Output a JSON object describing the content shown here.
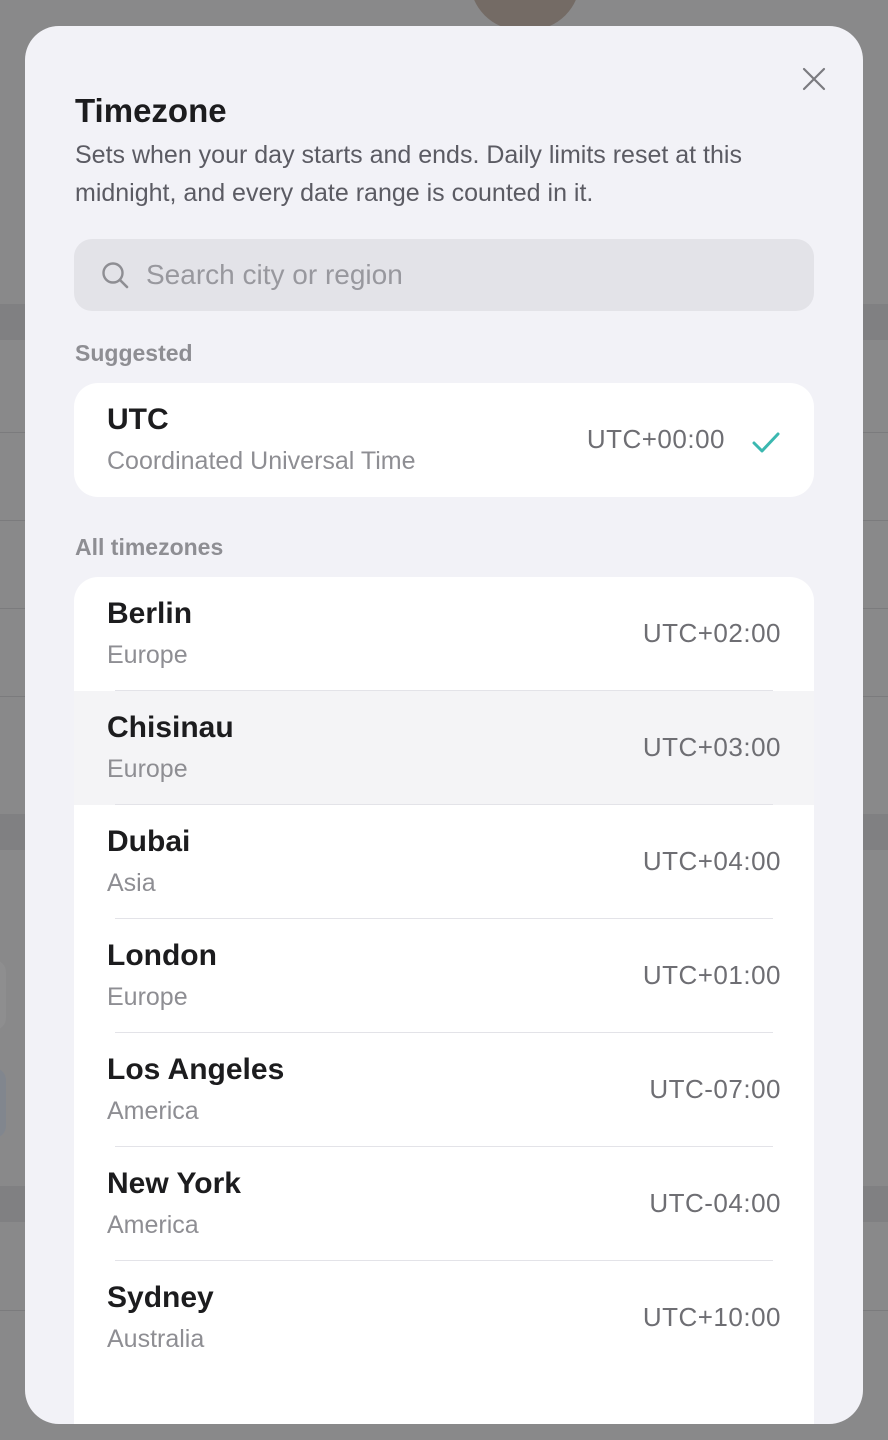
{
  "modal": {
    "title": "Timezone",
    "description": "Sets when your day starts and ends. Daily limits reset at this midnight, and every date range is counted in it.",
    "close_icon": "close-icon"
  },
  "search": {
    "placeholder": "Search city or region",
    "value": "",
    "icon": "search-icon"
  },
  "suggested": {
    "label": "Suggested",
    "item": {
      "name": "UTC",
      "region": "Coordinated Universal Time",
      "offset": "UTC+00:00",
      "selected": true,
      "check_icon": "checkmark-icon"
    }
  },
  "all": {
    "label": "All timezones",
    "items": [
      {
        "name": "Berlin",
        "region": "Europe",
        "offset": "UTC+02:00"
      },
      {
        "name": "Chisinau",
        "region": "Europe",
        "offset": "UTC+03:00"
      },
      {
        "name": "Dubai",
        "region": "Asia",
        "offset": "UTC+04:00"
      },
      {
        "name": "London",
        "region": "Europe",
        "offset": "UTC+01:00"
      },
      {
        "name": "Los Angeles",
        "region": "America",
        "offset": "UTC-07:00"
      },
      {
        "name": "New York",
        "region": "America",
        "offset": "UTC-04:00"
      },
      {
        "name": "Sydney",
        "region": "Australia",
        "offset": "UTC+10:00"
      }
    ]
  },
  "colors": {
    "accent_check": "#3bb8b0",
    "modal_bg": "#f2f2f7",
    "card_bg": "#ffffff",
    "scrim": "rgba(0,0,0,0.42)"
  }
}
